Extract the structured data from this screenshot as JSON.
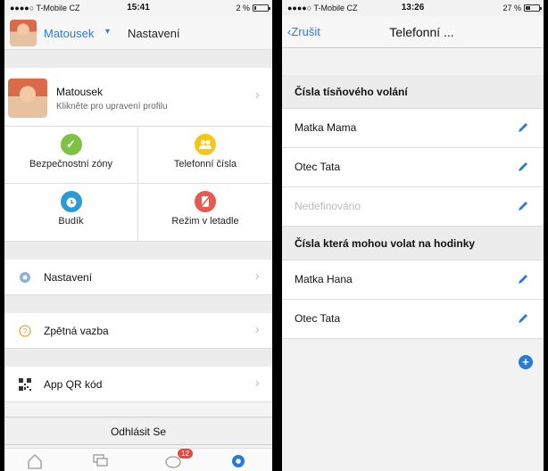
{
  "left": {
    "status": {
      "carrier": "●●●●○ T-Mobile CZ",
      "time": "15:41",
      "battery": "2 %",
      "battery_fill": 0.02
    },
    "nav": {
      "user": "Matousek",
      "title": "Nastavení"
    },
    "profile": {
      "name": "Matousek",
      "subtitle": "Klikněte pro upravení profilu"
    },
    "grid": [
      {
        "label": "Bezpečnostní zóny",
        "icon": "shield-check-icon",
        "color": "#7dc243"
      },
      {
        "label": "Telefonní čísla",
        "icon": "contacts-icon",
        "color": "#f5c518"
      },
      {
        "label": "Budík",
        "icon": "alarm-clock-icon",
        "color": "#2a9bd8"
      },
      {
        "label": "Režim v letadle",
        "icon": "airplane-mode-icon",
        "color": "#e85a4f"
      }
    ],
    "list": [
      {
        "label": "Nastavení",
        "icon": "gear-icon"
      },
      {
        "label": "Zpětná vazba",
        "icon": "feedback-icon"
      },
      {
        "label": "App QR kód",
        "icon": "qr-code-icon"
      }
    ],
    "logout": "Odhlásit Se",
    "tab_badge": "12"
  },
  "right": {
    "status": {
      "carrier": "●●●●○ T-Mobile CZ",
      "time": "13:26",
      "battery": "27 %",
      "battery_fill": 0.27
    },
    "nav": {
      "back": "‹Zrušit",
      "title": "Telefonní ..."
    },
    "section1": "Čísla tísňového volání",
    "emergency": [
      "Matka Mama",
      "Otec Tata",
      "Nedefinováno"
    ],
    "section2": "Čísla která mohou volat na hodinky",
    "allowed": [
      "Matka Hana",
      "Otec Tata"
    ]
  }
}
